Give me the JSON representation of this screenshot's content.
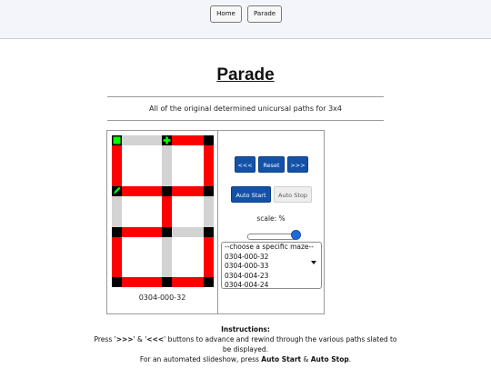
{
  "nav": {
    "home_label": "Home",
    "parade_label": "Parade"
  },
  "page": {
    "title": "Parade",
    "subtitle": "All of the original determined unicursal paths for 3x4"
  },
  "maze": {
    "id": "0304-000-32"
  },
  "controls": {
    "prev_label": "<<<",
    "reset_label": "Reset",
    "next_label": ">>>",
    "autostart_label": "Auto Start",
    "autostop_label": "Auto Stop",
    "scale_label": "scale: %",
    "scale_value": 0.98
  },
  "maze_select": {
    "placeholder": "--choose a specific maze--",
    "options": [
      "0304-000-32",
      "0304-000-33",
      "0304-004-23",
      "0304-004-24"
    ]
  },
  "instructions": {
    "heading": "Instructions:",
    "line1_pre": "Press '",
    "line1_next": ">>>",
    "line1_mid": "' & '",
    "line1_prev": "<<<",
    "line1_post": "' buttons to advance and rewind through the various paths slated to be displayed.",
    "line2_pre": "For an automated slideshow, press ",
    "line2_start": "Auto Start",
    "line2_amp": " & ",
    "line2_stop": "Auto Stop",
    "line2_post": "."
  },
  "colors": {
    "path": "#ff0000",
    "unused": "#d3d3d3",
    "node": "#000000",
    "marker": "#00ff00",
    "button": "#1452a8"
  },
  "icons": {
    "start": "green-square-icon",
    "finish": "green-cross-icon",
    "pencil": "pencil-icon"
  }
}
